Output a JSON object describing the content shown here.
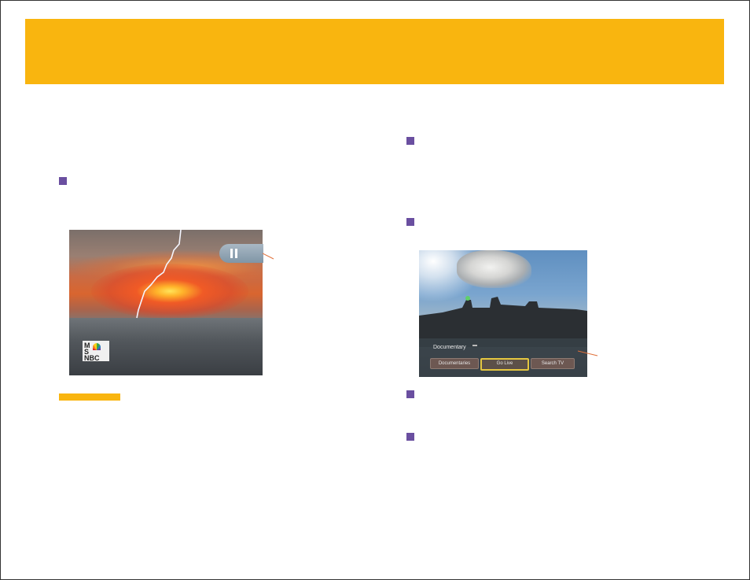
{
  "colors": {
    "banner": "#f9b50f",
    "bullet": "#6a4fa0",
    "callout": "#e0703a"
  },
  "left_screenshot": {
    "channel_logo": {
      "line1": "M",
      "line2": "S",
      "line3": "NBC"
    },
    "pause_icon": "pause-icon"
  },
  "right_screenshot": {
    "program_title": "Documentary",
    "program_tag": "",
    "time_label": "",
    "buttons": [
      {
        "label": "Documentaries"
      },
      {
        "label": "Go Live"
      },
      {
        "label": "Search TV"
      }
    ]
  }
}
